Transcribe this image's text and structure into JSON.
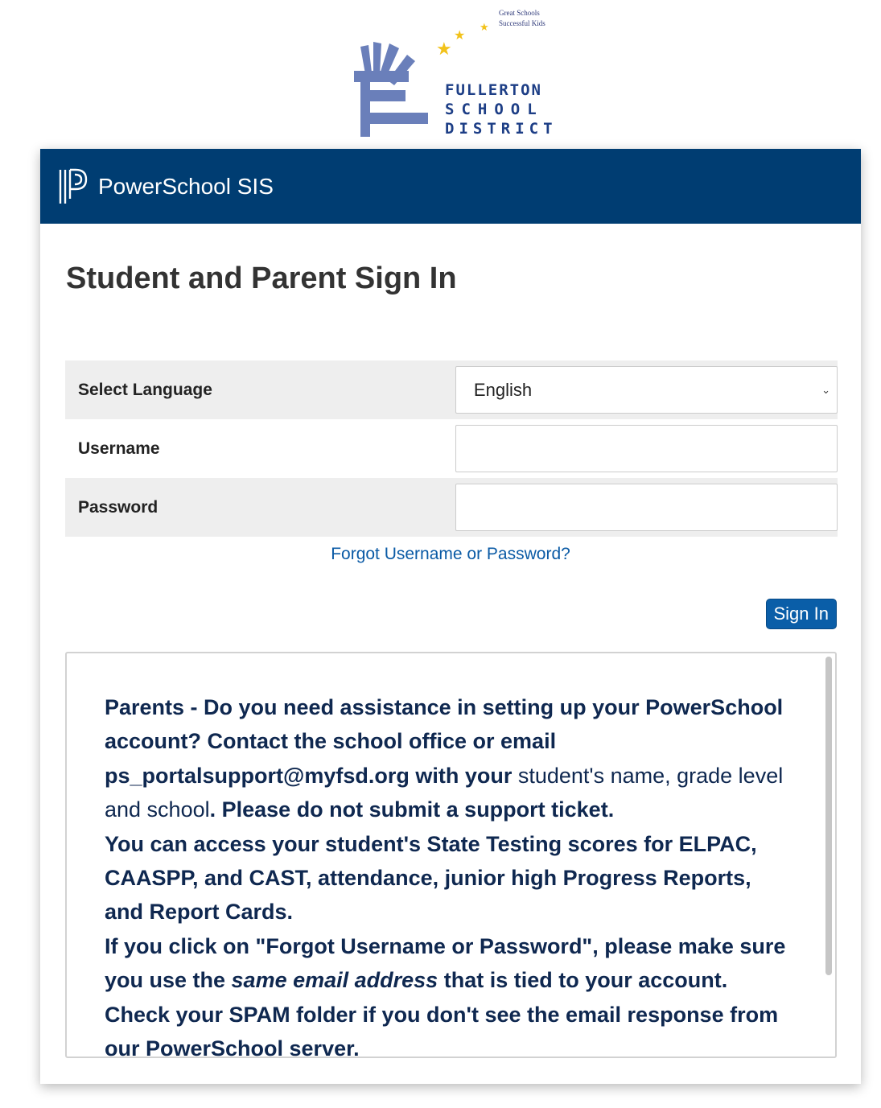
{
  "logo": {
    "tagline_line1": "Great Schools",
    "tagline_line2": "Successful Kids",
    "district_line1": "FULLERTON",
    "district_line2": "SCHOOL",
    "district_line3": "DISTRICT",
    "colors": {
      "navy": "#1d3e86",
      "hand": "#6a7fba",
      "star": "#f2c21a"
    }
  },
  "header": {
    "brand": "PowerSchool SIS",
    "color": "#003d72"
  },
  "page_title": "Student and Parent Sign In",
  "form": {
    "language_label": "Select Language",
    "language_value": "English",
    "username_label": "Username",
    "username_value": "",
    "password_label": "Password",
    "password_value": ""
  },
  "forgot_link": "Forgot Username or Password?",
  "signin_button": "Sign In",
  "notice": {
    "p1_bold_a": "Parents - Do you need assistance in setting up your PowerSchool account? Contact the school office or email ps_portalsupport@myfsd.org with your",
    "p1_normal": " student's name, grade level and school",
    "p1_bold_b": ". Please do not submit a support ticket.",
    "p2": "You can access your student's State Testing scores for ELPAC, CAASPP, and CAST, attendance, junior high Progress Reports, and Report Cards.",
    "p3_a": "If you click on \"Forgot Username or Password\", please make sure you use the ",
    "p3_italic": "same email address",
    "p3_b": " that is tied to your account. Check your SPAM folder if you don't see the email response from our PowerSchool server."
  }
}
